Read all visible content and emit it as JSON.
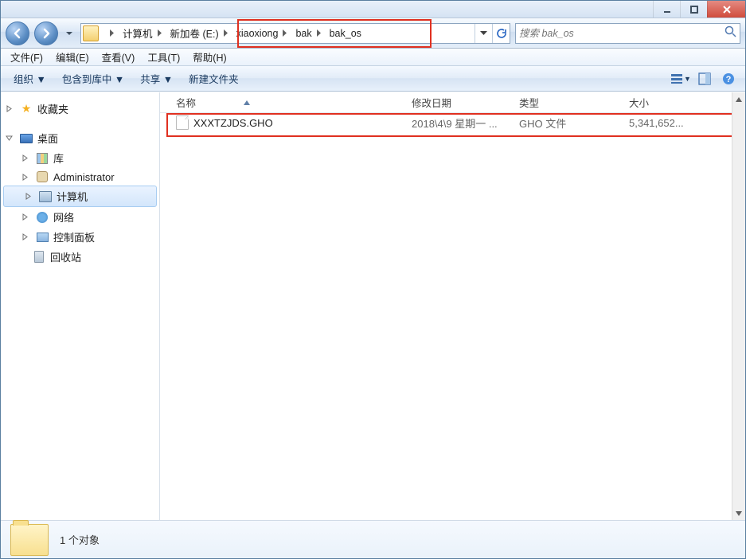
{
  "titlebar": {},
  "breadcrumbs": {
    "root_chev": "▸",
    "items": [
      "计算机",
      "新加卷 (E:)",
      "xiaoxiong",
      "bak",
      "bak_os"
    ],
    "highlight_start_index": 2
  },
  "search": {
    "placeholder": "搜索 bak_os"
  },
  "menubar": {
    "items": [
      "文件(F)",
      "编辑(E)",
      "查看(V)",
      "工具(T)",
      "帮助(H)"
    ]
  },
  "toolbar": {
    "organize": "组织 ▼",
    "include": "包含到库中 ▼",
    "share": "共享 ▼",
    "newfolder": "新建文件夹"
  },
  "sidebar": {
    "favorites": "收藏夹",
    "desktop": "桌面",
    "desktop_children": {
      "library": "库",
      "admin": "Administrator",
      "computer": "计算机",
      "network": "网络",
      "control_panel": "控制面板",
      "recycle_bin": "回收站"
    }
  },
  "columns": {
    "name": "名称",
    "date": "修改日期",
    "type": "类型",
    "size": "大小"
  },
  "files": [
    {
      "name": "XXXTZJDS.GHO",
      "date": "2018\\4\\9 星期一 ...",
      "type": "GHO 文件",
      "size": "5,341,652..."
    }
  ],
  "statusbar": {
    "count": "1 个对象"
  }
}
